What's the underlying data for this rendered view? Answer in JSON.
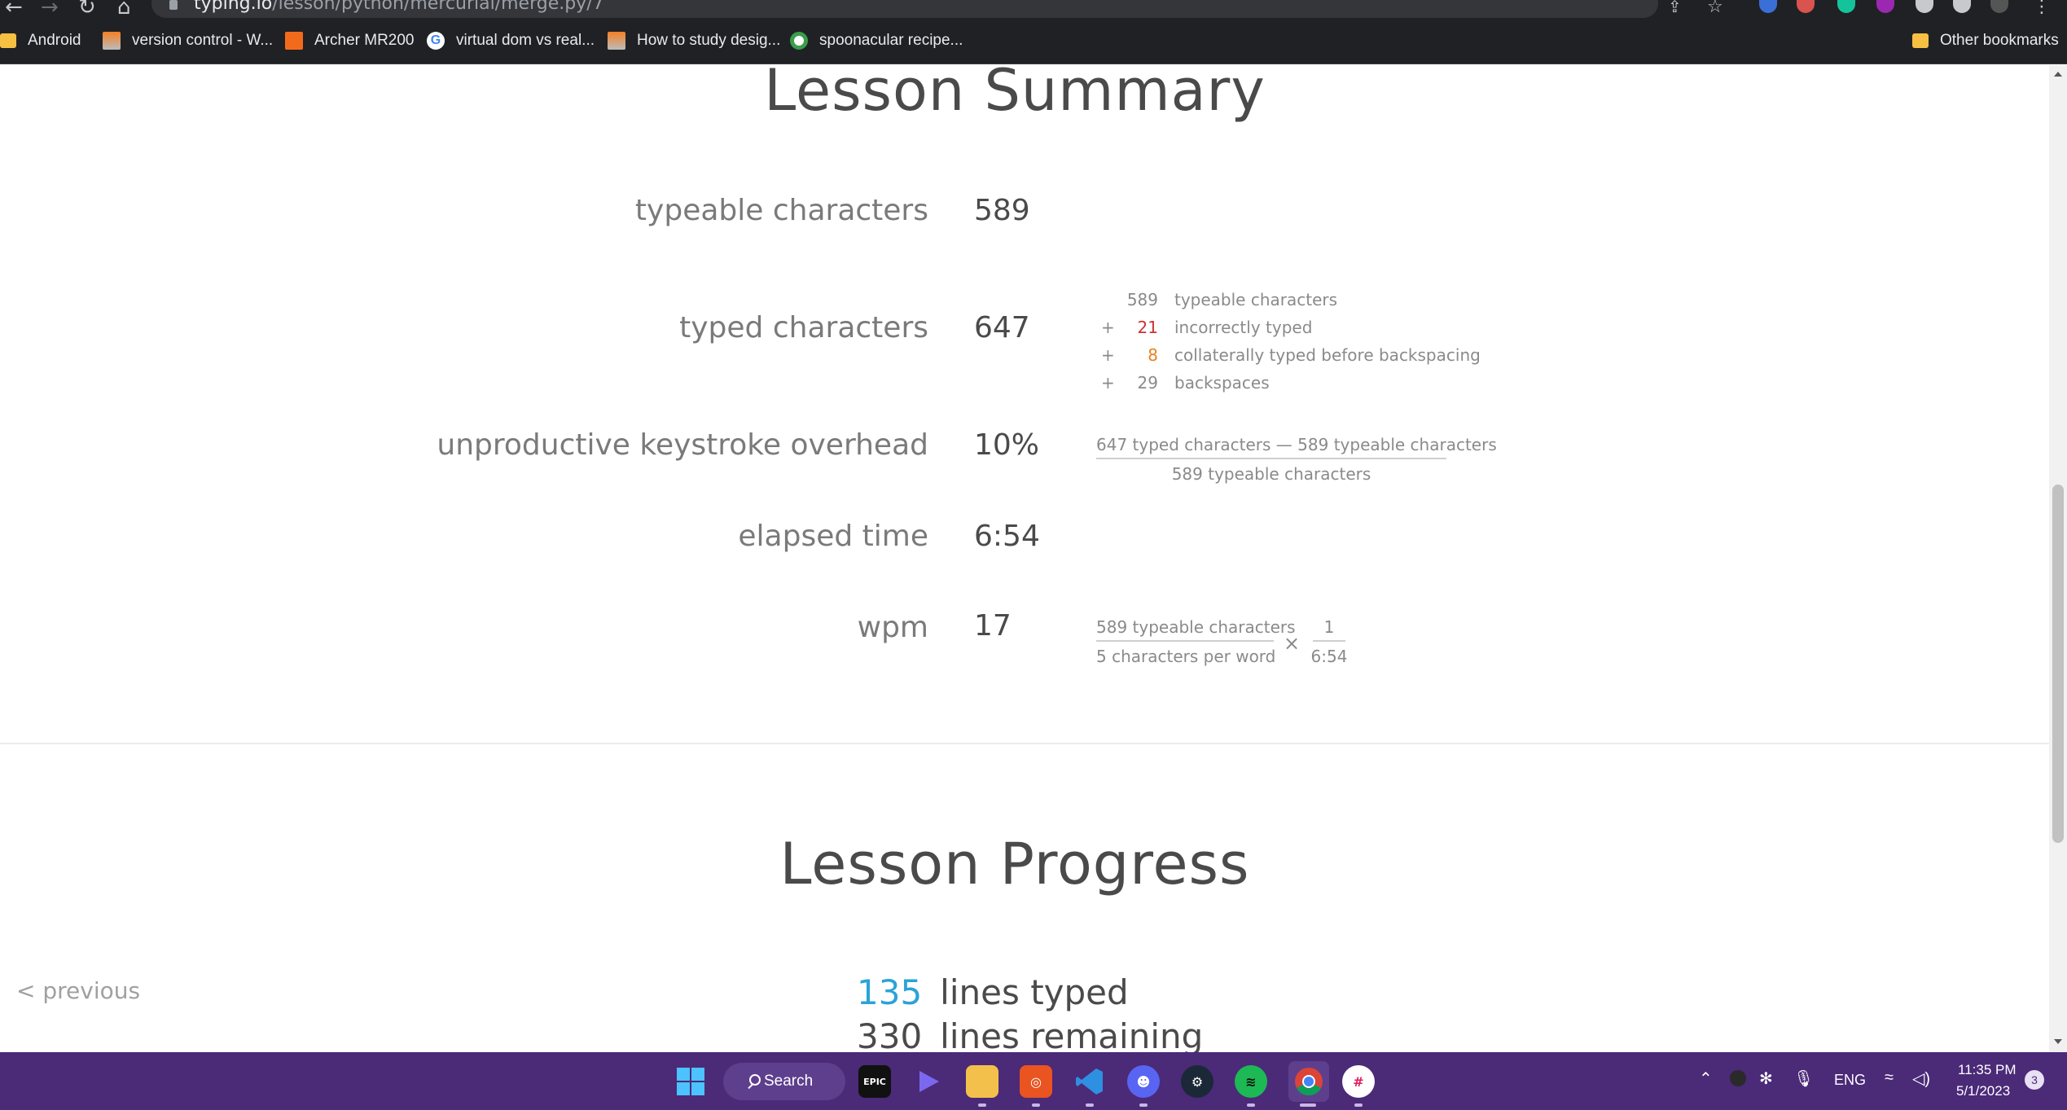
{
  "browser": {
    "url_host": "typing.io",
    "url_path": "/lesson/python/mercurial/merge.py/7",
    "bookmarks": [
      {
        "label": "Android",
        "icon": "folder-icon"
      },
      {
        "label": "version control - W...",
        "icon": "stackoverflow-icon"
      },
      {
        "label": "Archer MR200",
        "icon": "router-icon"
      },
      {
        "label": "virtual dom vs real...",
        "icon": "google-icon"
      },
      {
        "label": "How to study desig...",
        "icon": "stackoverflow-icon"
      },
      {
        "label": "spoonacular recipe...",
        "icon": "site-icon"
      }
    ],
    "other_bookmarks": "Other bookmarks"
  },
  "summary": {
    "title": "Lesson Summary",
    "rows": [
      {
        "label": "typeable characters",
        "value": "589"
      },
      {
        "label": "typed characters",
        "value": "647"
      },
      {
        "label": "unproductive keystroke overhead",
        "value": "10%"
      },
      {
        "label": "elapsed time",
        "value": "6:54"
      },
      {
        "label": "wpm",
        "value": "17"
      }
    ],
    "typed_breakdown": [
      {
        "op": "",
        "num": "589",
        "text": "typeable characters",
        "color": "#8a8a8a"
      },
      {
        "op": "+",
        "num": "21",
        "text": "incorrectly typed",
        "color": "#cc3333"
      },
      {
        "op": "+",
        "num": "8",
        "text": "collaterally typed before backspacing",
        "color": "#e8821e"
      },
      {
        "op": "+",
        "num": "29",
        "text": "backspaces",
        "color": "#8a8a8a"
      }
    ],
    "overhead_formula": {
      "numerator": "647 typed characters — 589 typeable characters",
      "denominator": "589 typeable characters"
    },
    "wpm_formula": {
      "numerator": "589 typeable characters",
      "denominator": "5 characters per word",
      "times": "×",
      "numerator2": "1",
      "denominator2": "6:54"
    }
  },
  "progress": {
    "title": "Lesson Progress",
    "previous_label": "< previous",
    "lines_typed": {
      "num": "135",
      "label": "lines typed"
    },
    "lines_remaining": {
      "num": "330",
      "label": "lines remaining"
    }
  },
  "taskbar": {
    "search_label": "Search",
    "apps": [
      "windows-start-icon",
      "epic-games-icon",
      "app-launcher-icon",
      "file-explorer-icon",
      "ubuntu-icon",
      "vscode-icon",
      "discord-icon",
      "steam-icon",
      "spotify-icon",
      "chrome-icon",
      "slack-icon"
    ],
    "language": "ENG",
    "time": "11:35 PM",
    "date": "5/1/2023",
    "notification_count": "3"
  },
  "colors": {
    "accent_blue": "#2aa3d8",
    "error_red": "#cc3333",
    "collateral_orange": "#e8821e",
    "taskbar": "#4b2a78"
  }
}
